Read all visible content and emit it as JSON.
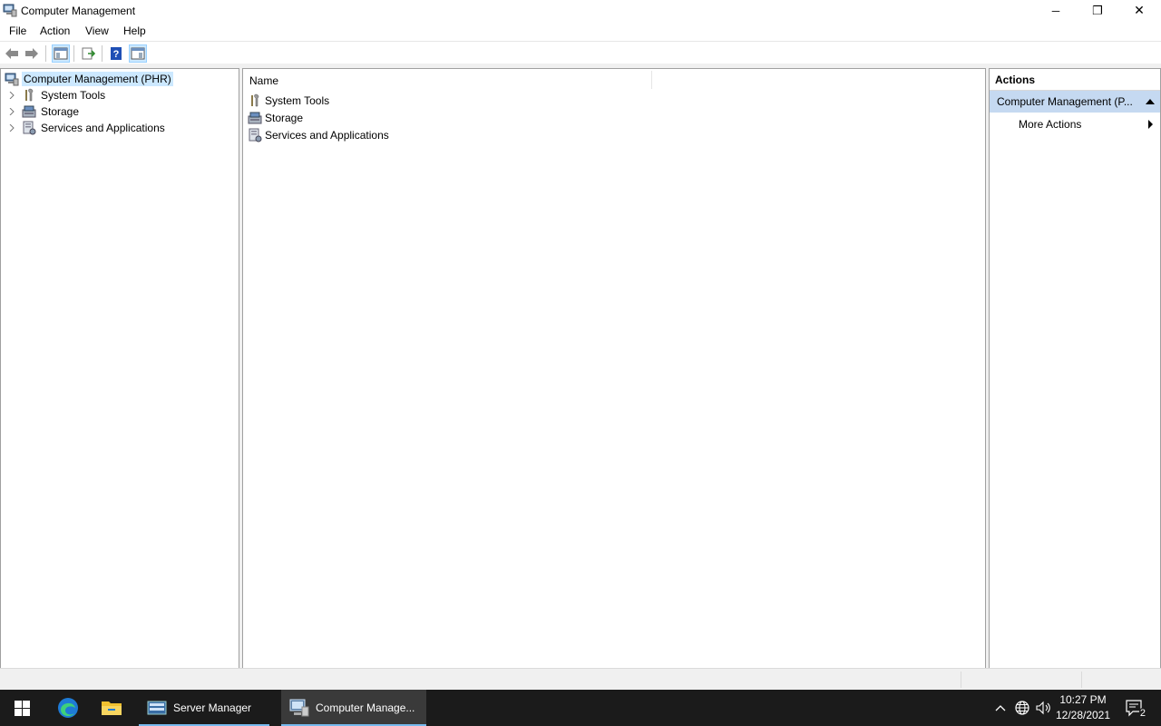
{
  "window": {
    "title": "Computer Management",
    "minimize_glyph": "─",
    "restore_glyph": "❐",
    "close_glyph": "✕"
  },
  "menu": {
    "file": "File",
    "action": "Action",
    "view": "View",
    "help": "Help"
  },
  "tree": {
    "root": "Computer Management (PHR)",
    "items": [
      {
        "label": "System Tools"
      },
      {
        "label": "Storage"
      },
      {
        "label": "Services and Applications"
      }
    ]
  },
  "content": {
    "column_name": "Name",
    "rows": [
      {
        "label": "System Tools"
      },
      {
        "label": "Storage"
      },
      {
        "label": "Services and Applications"
      }
    ]
  },
  "actions": {
    "header": "Actions",
    "group": "Computer Management (P...",
    "more": "More Actions"
  },
  "taskbar": {
    "apps": [
      {
        "label": "Server Manager"
      },
      {
        "label": "Computer Manage..."
      }
    ],
    "time": "10:27 PM",
    "date": "12/28/2021",
    "notifications": "2"
  }
}
